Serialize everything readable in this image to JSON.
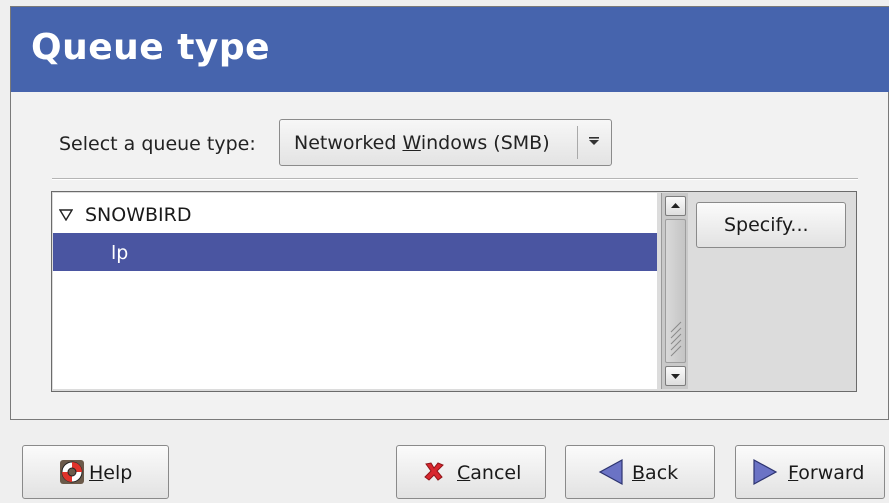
{
  "dialog": {
    "title": "Queue type"
  },
  "queue_type": {
    "label": "Select a queue type:",
    "selected_prefix": "Networked ",
    "selected_mnemonic": "W",
    "selected_suffix": "indows (SMB)"
  },
  "tree": {
    "items": [
      {
        "label": "SNOWBIRD",
        "expanded": true,
        "selected": false
      },
      {
        "label": "lp",
        "selected": true
      }
    ]
  },
  "buttons": {
    "specify": "Specify...",
    "help_mnemonic": "H",
    "help_rest": "elp",
    "cancel_mnemonic": "C",
    "cancel_rest": "ancel",
    "back_mnemonic": "B",
    "back_rest": "ack",
    "forward_mnemonic": "F",
    "forward_rest": "orward"
  },
  "colors": {
    "header": "#4664ad",
    "selection": "#4a55a1",
    "cancel_icon": "#d8262e",
    "nav_arrow": "#6b73c5"
  },
  "icons": [
    "lifebuoy-icon",
    "cancel-x-icon",
    "back-arrow-icon",
    "forward-arrow-icon",
    "expander-icon",
    "dropdown-arrow-icon"
  ]
}
